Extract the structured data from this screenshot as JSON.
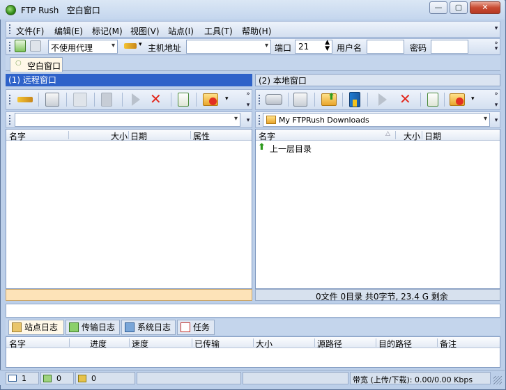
{
  "window": {
    "app_name": "FTP Rush",
    "title": "空白窗口",
    "min": "—",
    "max": "▢",
    "close": "✕"
  },
  "menu": [
    "文件(F)",
    "编辑(E)",
    "标记(M)",
    "视图(V)",
    "站点(I)",
    "工具(T)",
    "帮助(H)"
  ],
  "connect": {
    "proxy": "不使用代理",
    "host_label": "主机地址",
    "host_value": "",
    "port_label": "端口",
    "port_value": "21",
    "user_label": "用户名",
    "user_value": "",
    "pass_label": "密码",
    "pass_value": ""
  },
  "tab": {
    "label": "空白窗口"
  },
  "remote": {
    "title": "(1) 远程窗口",
    "path": "",
    "cols": [
      "名字",
      "大小",
      "日期",
      "属性"
    ],
    "status": ""
  },
  "local": {
    "title": "(2) 本地窗口",
    "path": "My FTPRush Downloads",
    "cols": [
      "名字",
      "大小",
      "日期"
    ],
    "up_item": "上一层目录",
    "status": "0文件 0目录 共0字节, 23.4 G 剩余"
  },
  "log_tabs": [
    "站点日志",
    "传输日志",
    "系统日志",
    "任务"
  ],
  "queue_cols": [
    "名字",
    "进度",
    "速度",
    "已传输",
    "大小",
    "源路径",
    "目的路径",
    "备注"
  ],
  "statusbar": {
    "windows": "1",
    "uploads": "0",
    "downloads": "0",
    "bandwidth": "带宽 (上传/下载): 0.00/0.00 Kbps"
  },
  "colors": {
    "active_header": "#2e62c9",
    "remote_status": "#fde3b8",
    "chrome": "#bccfe9"
  }
}
